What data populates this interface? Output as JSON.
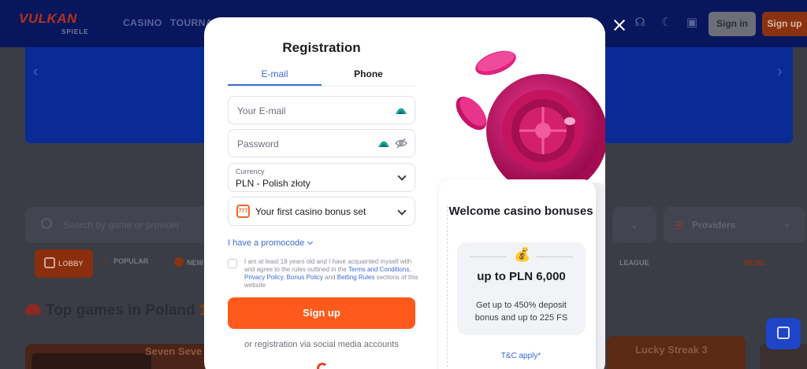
{
  "background": {
    "logo_main": "VULKAN",
    "logo_sub": "SPIELE",
    "nav": [
      "CASINO",
      "TOURNAM"
    ],
    "signin_label": "Sign in",
    "signup_label": "Sign up",
    "search_placeholder": "Search by game or provider",
    "providers_label": "Providers",
    "chips": {
      "lobby": "LOBBY",
      "popular": "POPULAR",
      "new": "NEW",
      "league": "LEAGUE",
      "more": "MORE"
    },
    "top_games_prefix": "Top games in Poland",
    "top_games_num": "1",
    "game_titles": [
      "Seven Seve",
      "Lucky Streak 3"
    ]
  },
  "modal": {
    "title": "Registration",
    "tabs": [
      {
        "label": "E-mail",
        "active": true
      },
      {
        "label": "Phone",
        "active": false
      }
    ],
    "email_placeholder": "Your E-mail",
    "password_placeholder": "Password",
    "currency": {
      "label": "Currency",
      "value": "PLN - Polish złoty"
    },
    "bonus_label": "Your first casino bonus set",
    "promo_link": "I have a promocode",
    "agree": {
      "text1": "I am at least 18 years old and I have acquainted myself with and agree to the rules outlined in the",
      "link_terms": "Terms and Conditions",
      "link_privacy": "Privacy Policy",
      "link_bonus": "Bonus Policy",
      "and_word": "and",
      "link_betting": "Betting Rules",
      "text2": "sections of this website"
    },
    "signup_button": "Sign up",
    "social_text": "or registration via social media accounts"
  },
  "promo": {
    "welcome_title": "Welcome casino bonuses",
    "amount": "up to PLN 6,000",
    "description": "Get up to 450% deposit bonus and up to 225 FS",
    "tc": "T&C apply*"
  },
  "colors": {
    "accent": "#ff5a1c",
    "link": "#3b6bd6",
    "roulette": "#d0176e"
  }
}
